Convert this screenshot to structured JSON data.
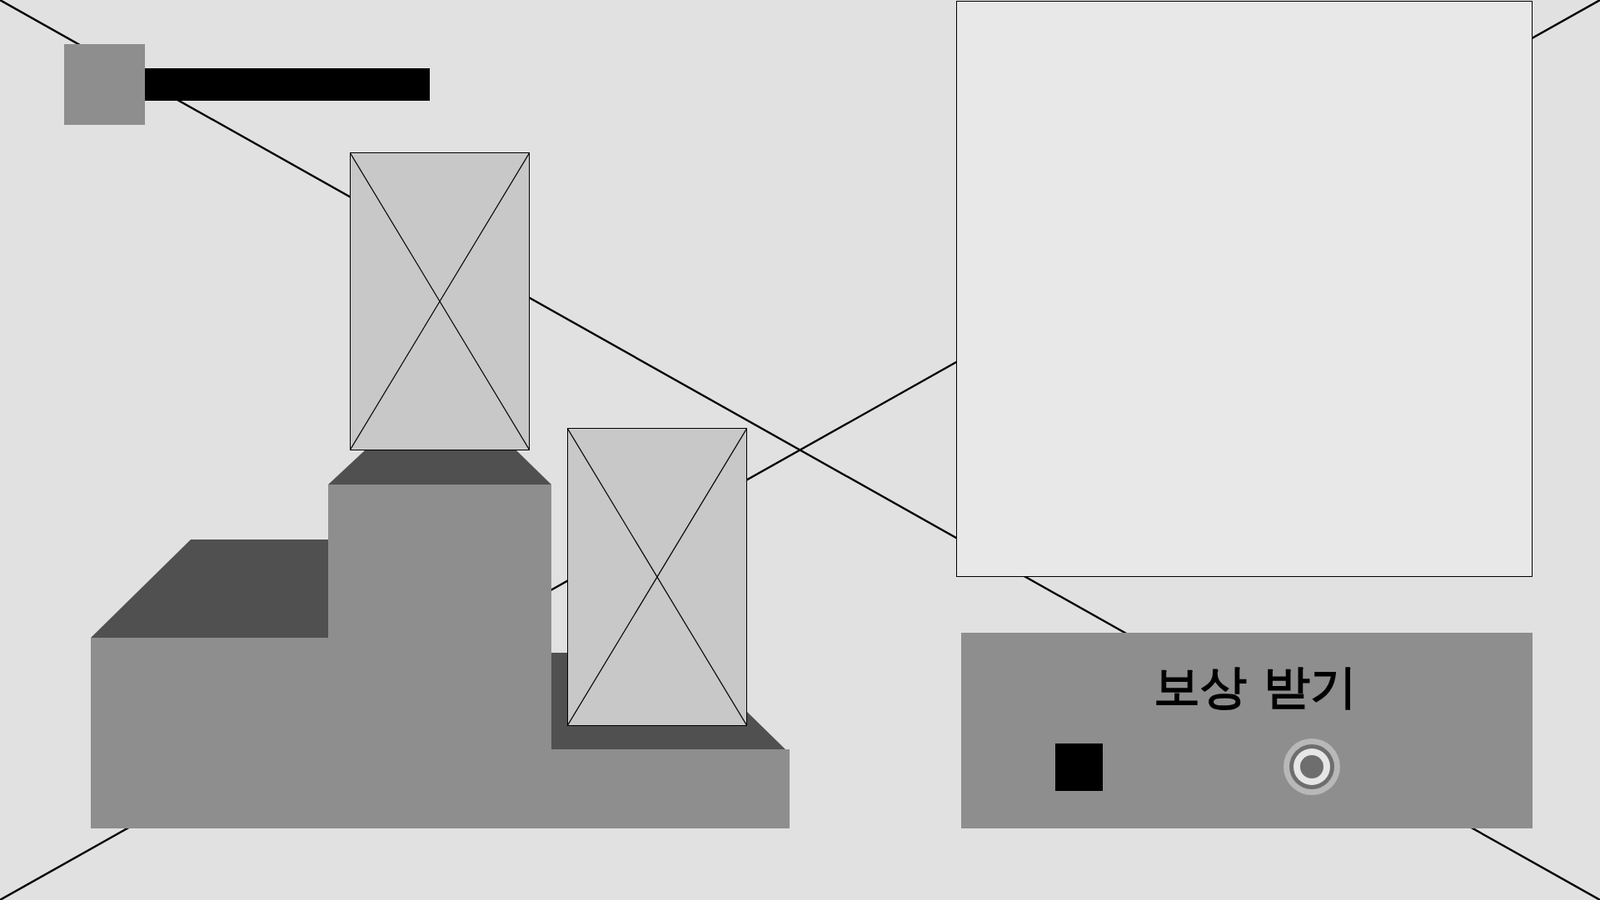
{
  "reward_button": {
    "label": "보상 받기"
  }
}
